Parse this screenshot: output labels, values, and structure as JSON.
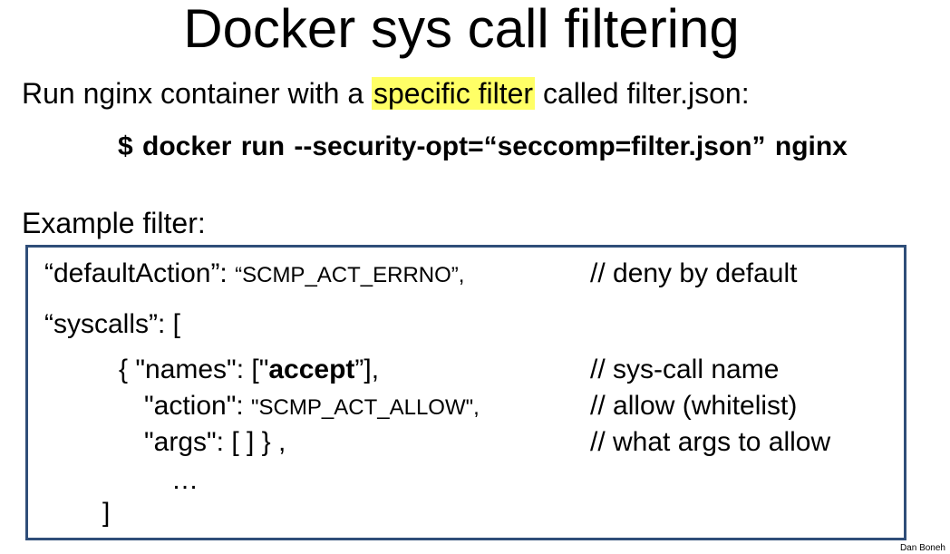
{
  "title": "Docker sys call filtering",
  "intro": {
    "before": "Run nginx container with a ",
    "highlight": "specific filter",
    "after": " called filter.json:"
  },
  "highlight_color": "#ffff66",
  "command": "$  docker  run  --security-opt=“seccomp=filter.json”   nginx",
  "example_label": "Example filter:",
  "code": {
    "line1_key": "“defaultAction”:  ",
    "line1_value": "“SCMP_ACT_ERRNO”,",
    "line1_comment": "//  deny by default",
    "line2": "“syscalls”: [",
    "line3_pre": "{  \"names\":  [\"",
    "line3_bold": "accept",
    "line3_post": "”],",
    "line3_comment": "//  sys-call name",
    "line4_key": "\"action\":  ",
    "line4_value": "\"SCMP_ACT_ALLOW\",",
    "line4_comment": "//  allow (whitelist)",
    "line5": "\"args\": [ ]  } ,",
    "line5_comment": "// what args to allow",
    "line6": "…",
    "line7": "]"
  },
  "box_border_color": "#2f4e79",
  "credit": "Dan Boneh"
}
